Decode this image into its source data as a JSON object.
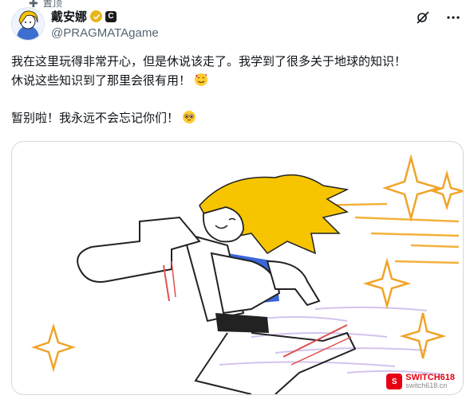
{
  "pinned": {
    "label": "置顶"
  },
  "author": {
    "display_name": "戴安娜",
    "handle": "@PRAGMATAgame"
  },
  "tweet": {
    "line1": "我在这里玩得非常开心，但是休说该走了。我学到了很多关于地球的知识！",
    "line2": "休说这些知识到了那里会很有用！",
    "line3": "暂别啦！我永远不会忘记你们！"
  },
  "icons": {
    "pin": "pin-icon",
    "verified": "gold-checkmark-icon",
    "affiliate": "affiliate-badge-icon",
    "grok": "grok-icon",
    "more": "more-icon",
    "emoji1": "smiling-face-with-hearts-icon",
    "emoji2": "pleading-face-icon"
  },
  "colors": {
    "verified_gold": "#e8b51a",
    "secondary_text": "#536471",
    "hair_yellow": "#f6c500",
    "jacket_blue": "#3a66d9"
  },
  "watermark": {
    "title": "SWITCH618",
    "sub": "switch618.cn"
  }
}
